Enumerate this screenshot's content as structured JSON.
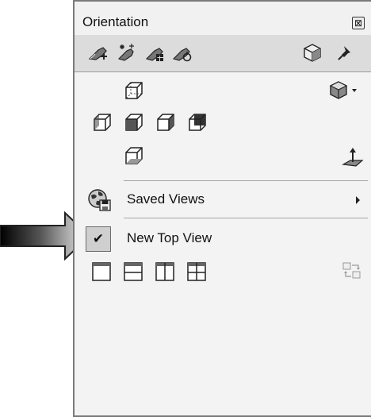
{
  "panel": {
    "title": "Orientation",
    "close_glyph": "⊠",
    "toolbar": {
      "icons": [
        "view-tool-icon-1",
        "view-tool-icon-2",
        "view-tool-icon-3",
        "view-tool-icon-4",
        "view-cube-icon",
        "pin-icon"
      ]
    },
    "view_cubes": {
      "top_row": [
        "top-view-cube-icon",
        "display-style-dropdown-icon"
      ],
      "middle_row": [
        "left-view-cube-icon",
        "front-view-cube-icon",
        "right-view-cube-icon",
        "back-view-cube-icon"
      ],
      "bottom_row": [
        "bottom-view-cube-icon",
        "normal-to-icon"
      ]
    },
    "menu": {
      "saved_views_label": "Saved Views",
      "new_view_label": "New Top View",
      "new_view_checked": true,
      "check_glyph": "✔"
    },
    "viewport_layouts": [
      "single-viewport-icon",
      "two-horizontal-viewport-icon",
      "two-vertical-viewport-icon",
      "four-viewport-icon",
      "link-views-icon"
    ]
  },
  "colors": {
    "panel_bg": "#f1f1f1",
    "toolbar_bg": "#dcdcdc",
    "check_bg": "#cfcfcf"
  }
}
